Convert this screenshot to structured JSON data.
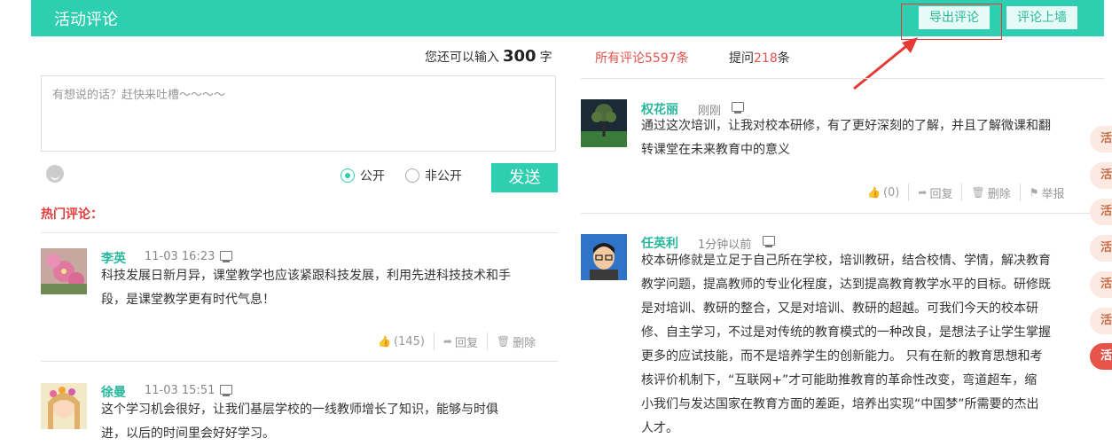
{
  "header": {
    "title": "活动评论",
    "export_label": "导出评论",
    "wall_label": "评论上墙"
  },
  "composer": {
    "counter_prefix": "您还可以输入",
    "counter_value": "300",
    "counter_suffix": "字",
    "placeholder": "有想说的话？赶快来吐槽～～～～",
    "public_label": "公开",
    "private_label": "非公开",
    "send_label": "发送"
  },
  "hot_title": "热门评论：",
  "hot_comments": [
    {
      "name": "李英",
      "time": "11-03 16:23",
      "text1": "科技发展日新月异，课堂教学也应该紧跟科技发展，利用先进科技技术和手",
      "text2": "段，是课堂教学更有时代气息！",
      "likes": "(145)",
      "reply": "回复",
      "delete": "删除"
    },
    {
      "name": "徐曼",
      "time": "11-03 15:51",
      "text1": "这个学习机会很好，让我们基层学校的一线教师增长了知识，能够与时俱",
      "text2": "进，以后的时间里会好好学习。"
    }
  ],
  "tabs": {
    "all": "所有评论5597条",
    "q_prefix": "提问",
    "q_count": "218",
    "q_suffix": "条"
  },
  "comments": [
    {
      "name": "权花丽",
      "time": "刚刚",
      "lines": [
        "通过这次培训，让我对校本研修，有了更好深刻的了解，并且了解微课和翻",
        "转课堂在未来教育中的意义"
      ],
      "likes": "(0)",
      "reply": "回复",
      "delete": "删除",
      "report": "举报"
    },
    {
      "name": "任英利",
      "time": "1分钟以前",
      "lines": [
        "校本研修就是立足于自己所在学校，培训教研，结合校情、学情，解决教育",
        "教学问题，提高教师的专业化程度，达到提高教育教学水平的目标。研修既",
        "是对培训、教研的整合，又是对培训、教研的超越。可我们今天的校本研",
        "修、自主学习，不过是对传统的教育模式的一种改良，是想法子让学生掌握",
        "更多的应试技能，而不是培养学生的创新能力。 只有在新的教育思想和考",
        "核评价机制下，“互联网+”才可能助推教育的革命性改变，弯道超车，缩",
        "小我们与发达国家在教育方面的差距，培养出实现“中国梦”所需要的杰出",
        "人才。"
      ]
    }
  ],
  "side_tabs": [
    "活",
    "活",
    "活",
    "活",
    "活",
    "活",
    "活"
  ],
  "colors": {
    "accent": "#2ecfb1",
    "highlight": "#e53935"
  }
}
